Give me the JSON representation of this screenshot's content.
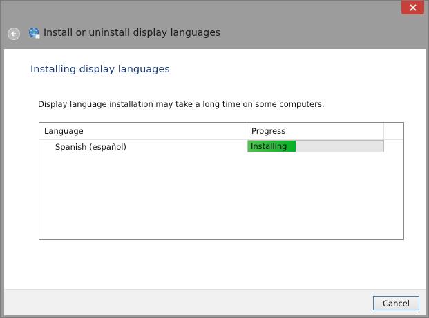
{
  "window": {
    "title": "Install or uninstall display languages",
    "close_icon": "close-icon",
    "back_icon": "back-arrow-icon",
    "app_icon": "globe-language-icon"
  },
  "page": {
    "heading": "Installing display languages",
    "description": "Display language installation may take a long time on some computers."
  },
  "list": {
    "columns": [
      "Language",
      "Progress"
    ],
    "rows": [
      {
        "language": "Spanish (español)",
        "status": "Installing",
        "progress": 0.35
      }
    ]
  },
  "footer": {
    "cancel_label": "Cancel"
  },
  "colors": {
    "heading": "#1e3f7a",
    "progress_fill": "#06b025",
    "close_button": "#c7403a"
  }
}
